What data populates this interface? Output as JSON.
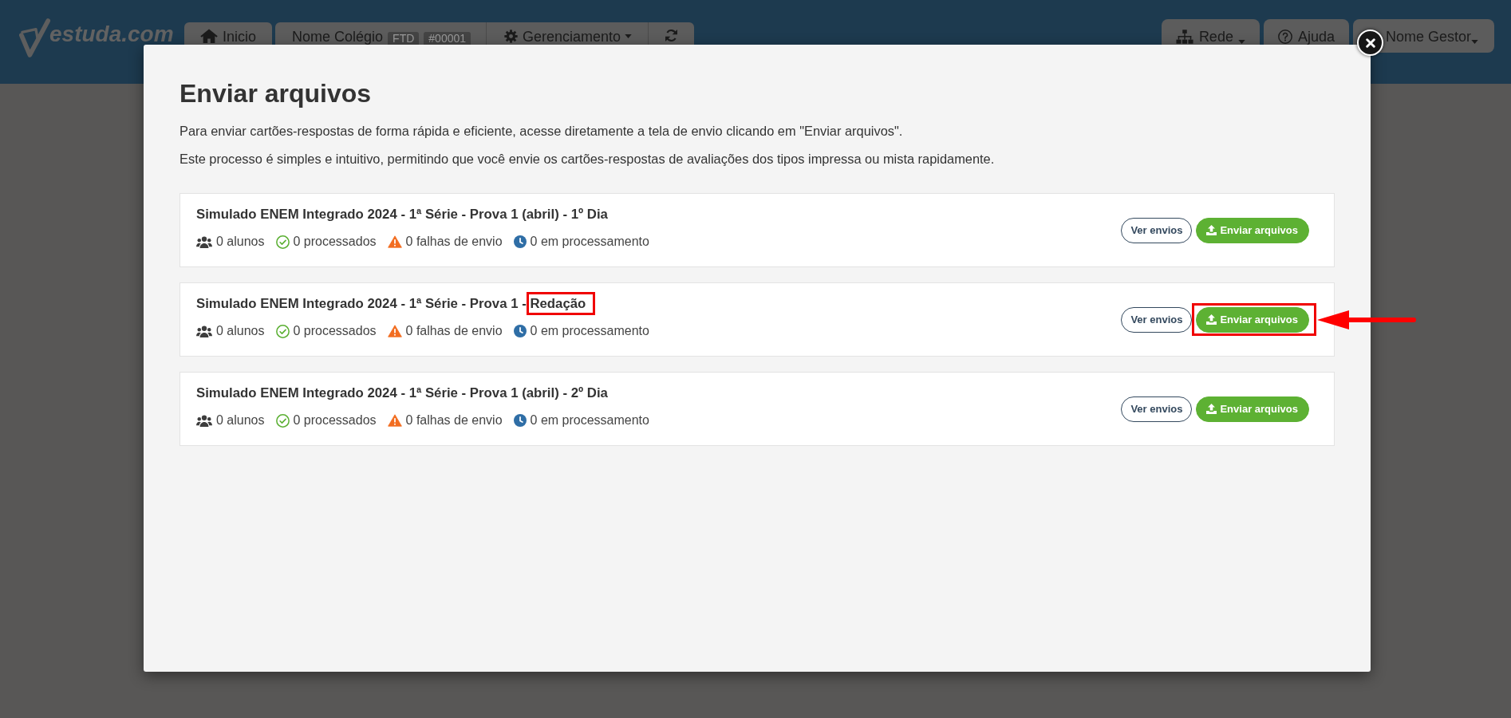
{
  "header": {
    "logo": "estuda.com",
    "nav": [
      {
        "kind": "home",
        "label": "Inicio"
      }
    ],
    "group": [
      {
        "kind": "school",
        "label": "Nome Colégio",
        "tags": [
          "FTD",
          "#00001"
        ]
      },
      {
        "kind": "settings",
        "label": "Gerenciamento",
        "caret": true
      },
      {
        "kind": "refresh"
      }
    ],
    "right_nav": [
      {
        "kind": "network",
        "label": "Rede",
        "caret": true
      },
      {
        "kind": "help",
        "label": "Ajuda",
        "caret": false
      },
      {
        "kind": "user",
        "label": "Nome Gestor",
        "caret": true
      }
    ]
  },
  "modal": {
    "title": "Enviar arquivos",
    "paragraphs": [
      "Para enviar cartões-respostas de forma rápida e eficiente, acesse diretamente a tela de envio clicando em \"Enviar arquivos\".",
      "Este processo é simples e intuitivo, permitindo que você envie os cartões-respostas de avaliações dos tipos impressa ou mista rapidamente."
    ],
    "assessments": [
      {
        "title": [
          {
            "text": "Simulado ENEM Integrado 2024 - 1ª Série - Prova 1 (abril) - 1º Dia",
            "highlighted": false
          }
        ],
        "stats": [
          {
            "kind": "students",
            "text": "0 alunos"
          },
          {
            "kind": "processed",
            "text": "0 processados"
          },
          {
            "kind": "failed",
            "text": "0 falhas de envio"
          },
          {
            "kind": "processing",
            "text": "0 em processamento"
          }
        ],
        "actions": [
          {
            "kind": "secondary",
            "label": "Ver envios",
            "highlighted": false,
            "arrow": false
          },
          {
            "kind": "upload",
            "label": "Enviar arquivos",
            "highlighted": false,
            "arrow": false
          }
        ]
      },
      {
        "title": [
          {
            "text": "Simulado ENEM Integrado 2024 - 1ª Série - Prova 1 - ",
            "highlighted": false
          },
          {
            "text": "Redação",
            "highlighted": true
          }
        ],
        "stats": [
          {
            "kind": "students",
            "text": "0 alunos"
          },
          {
            "kind": "processed",
            "text": "0 processados"
          },
          {
            "kind": "failed",
            "text": "0 falhas de envio"
          },
          {
            "kind": "processing",
            "text": "0 em processamento"
          }
        ],
        "actions": [
          {
            "kind": "secondary",
            "label": "Ver envios",
            "highlighted": false,
            "arrow": false
          },
          {
            "kind": "upload",
            "label": "Enviar arquivos",
            "highlighted": true,
            "arrow": true
          }
        ]
      },
      {
        "title": [
          {
            "text": "Simulado ENEM Integrado 2024 - 1ª Série - Prova 1 (abril) - 2º Dia",
            "highlighted": false
          }
        ],
        "stats": [
          {
            "kind": "students",
            "text": "0 alunos"
          },
          {
            "kind": "processed",
            "text": "0 processados"
          },
          {
            "kind": "failed",
            "text": "0 falhas de envio"
          },
          {
            "kind": "processing",
            "text": "0 em processamento"
          }
        ],
        "actions": [
          {
            "kind": "secondary",
            "label": "Ver envios",
            "highlighted": false,
            "arrow": false
          },
          {
            "kind": "upload",
            "label": "Enviar arquivos",
            "highlighted": false,
            "arrow": false
          }
        ]
      }
    ]
  }
}
